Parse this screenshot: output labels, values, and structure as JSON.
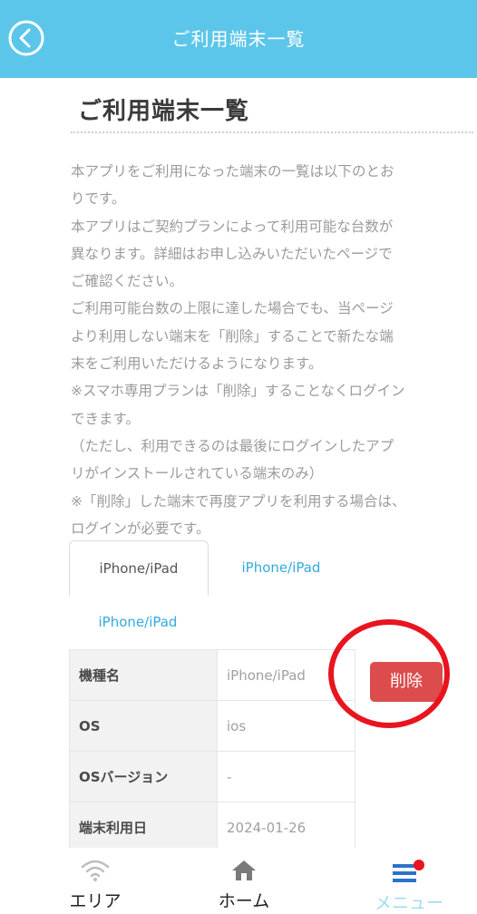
{
  "header": {
    "title": "ご利用端末一覧"
  },
  "page": {
    "title": "ご利用端末一覧"
  },
  "description": [
    "本アプリをご利用になった端末の一覧は以下のとお",
    "りです。",
    "本アプリはご契約プランによって利用可能な台数が",
    "異なります。詳細はお申し込みいただいたページで",
    "ご確認ください。",
    "ご利用可能台数の上限に達した場合でも、当ページ",
    "より利用しない端末を「削除」することで新たな端",
    "末をご利用いただけるようになります。",
    "※スマホ専用プランは「削除」することなくログイン",
    "できます。",
    "（ただし、利用できるのは最後にログインしたアプ",
    "リがインストールされている端末のみ）",
    "※「削除」した端末で再度アプリを利用する場合は、",
    "ログインが必要です。"
  ],
  "tabs": [
    "iPhone/iPad",
    "iPhone/iPad",
    "iPhone/iPad"
  ],
  "device_table": {
    "rows": [
      {
        "label": "機種名",
        "value": "iPhone/iPad"
      },
      {
        "label": "OS",
        "value": "ios"
      },
      {
        "label": "OSバージョン",
        "value": "-"
      },
      {
        "label": "端末利用日",
        "value": "2024-01-26"
      }
    ],
    "delete_label": "削除"
  },
  "bottom_nav": {
    "items": [
      {
        "label": "エリア",
        "icon": "wifi-icon"
      },
      {
        "label": "ホーム",
        "icon": "home-icon"
      },
      {
        "label": "メニュー",
        "icon": "menu-icon"
      }
    ]
  },
  "colors": {
    "header": "#5cc6ea",
    "accent": "#33aadd",
    "delete": "#dc4c4c",
    "annotation": "#e8141f"
  }
}
